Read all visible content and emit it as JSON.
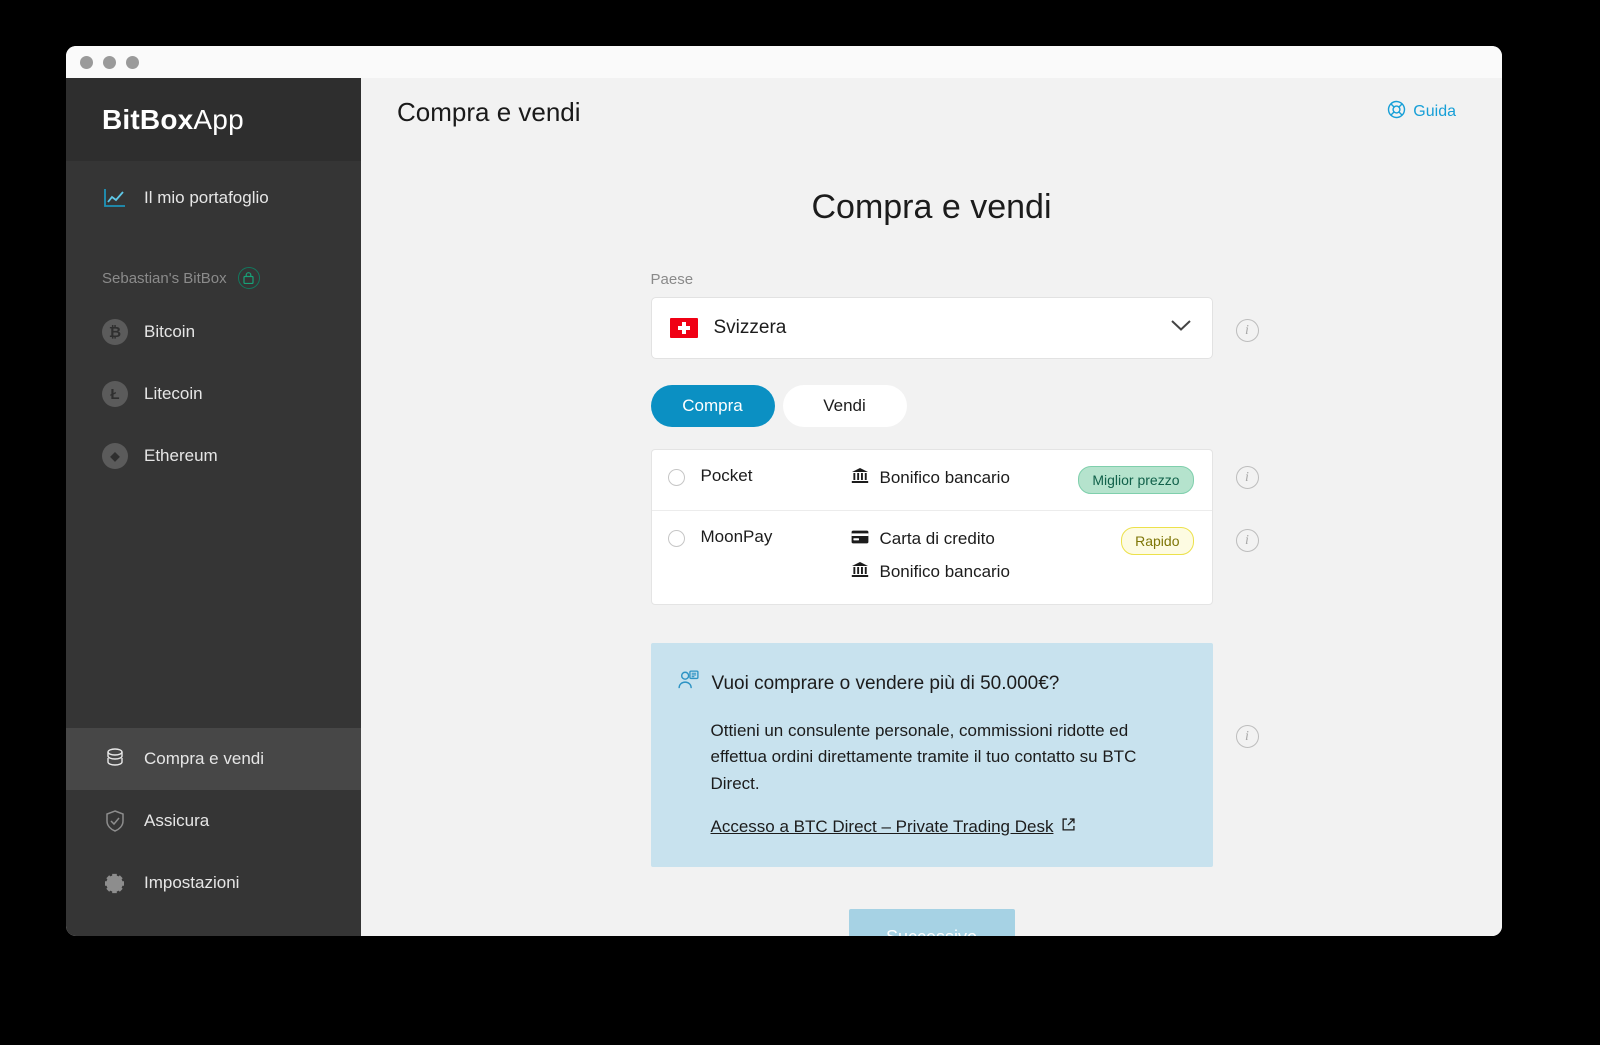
{
  "window": {
    "traffic_lights": [
      "close",
      "minimize",
      "zoom"
    ]
  },
  "sidebar": {
    "brand_bold": "BitBox",
    "brand_light": "App",
    "portfolio": {
      "label": "Il mio portafoglio",
      "icon": "chart-line-icon"
    },
    "account_section": {
      "label": "Sebastian's BitBox",
      "badge_icon": "bitbox-lock-icon"
    },
    "accounts": [
      {
        "label": "Bitcoin",
        "symbol": "₿",
        "icon": "bitcoin-icon"
      },
      {
        "label": "Litecoin",
        "symbol": "Ł",
        "icon": "litecoin-icon"
      },
      {
        "label": "Ethereum",
        "symbol": "◆",
        "icon": "ethereum-icon"
      }
    ],
    "bottom_items": [
      {
        "label": "Compra e vendi",
        "icon": "coins-icon",
        "active": true
      },
      {
        "label": "Assicura",
        "icon": "shield-check-icon",
        "active": false
      },
      {
        "label": "Impostazioni",
        "icon": "gear-icon",
        "active": false
      }
    ]
  },
  "header": {
    "title": "Compra e vendi",
    "guide_label": "Guida",
    "guide_icon": "lifebuoy-icon"
  },
  "main": {
    "page_title": "Compra e vendi",
    "country": {
      "label": "Paese",
      "value": "Svizzera",
      "flag": "switzerland-flag",
      "chevron": "chevron-down-icon"
    },
    "mode_toggle": {
      "buy_label": "Compra",
      "sell_label": "Vendi",
      "selected": "Compra"
    },
    "providers": [
      {
        "name": "Pocket",
        "selected": false,
        "methods": [
          {
            "label": "Bonifico bancario",
            "icon": "bank-icon"
          }
        ],
        "badge": {
          "text": "Miglior prezzo",
          "style": "green"
        }
      },
      {
        "name": "MoonPay",
        "selected": false,
        "methods": [
          {
            "label": "Carta di credito",
            "icon": "credit-card-icon"
          },
          {
            "label": "Bonifico bancario",
            "icon": "bank-icon"
          }
        ],
        "badge": {
          "text": "Rapido",
          "style": "yellow"
        }
      }
    ],
    "promo": {
      "icon": "advisor-icon",
      "heading": "Vuoi comprare o vendere più di 50.000€?",
      "body": "Ottieni un consulente personale, commissioni ridotte ed effettua ordini direttamente tramite il tuo contatto su BTC Direct.",
      "link_text": "Accesso a BTC Direct – Private Trading Desk",
      "link_icon": "external-link-icon"
    },
    "next_button": {
      "label": "Successivo",
      "disabled": true
    },
    "info_icons": [
      "info-icon",
      "info-icon",
      "info-icon",
      "info-icon"
    ]
  },
  "colors": {
    "accent_blue": "#0b90c3",
    "link_blue": "#179fd7",
    "promo_bg": "#c8e2ee",
    "badge_green_bg": "#b5e3cd",
    "badge_yellow_bg": "#fdfbe2",
    "sidebar_bg": "#353535",
    "sidebar_header_bg": "#2e2e2e",
    "sidebar_active_bg": "#474747",
    "next_disabled_bg": "#a6d2e4",
    "flag_red": "#f00014"
  }
}
